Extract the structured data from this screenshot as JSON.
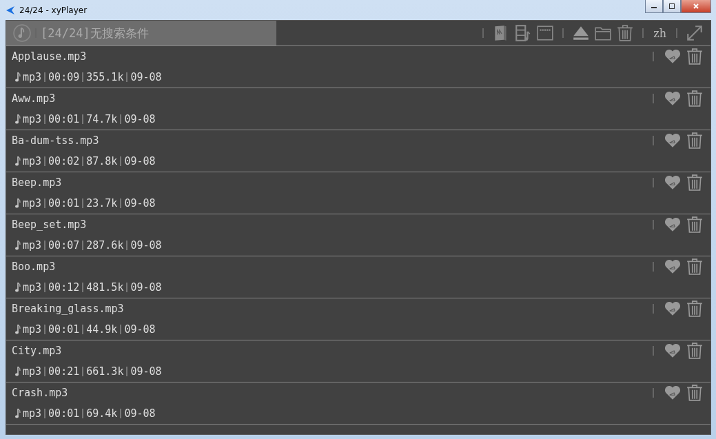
{
  "window": {
    "title": "24/24 - xyPlayer"
  },
  "search": {
    "placeholder": "[24/24]无搜索条件"
  },
  "toolbar": {
    "language": "zh"
  },
  "tracks": [
    {
      "name": "Applause.mp3",
      "format": "mp3",
      "duration": "00:09",
      "size": "355.1k",
      "date": "09-08"
    },
    {
      "name": "Aww.mp3",
      "format": "mp3",
      "duration": "00:01",
      "size": "74.7k",
      "date": "09-08"
    },
    {
      "name": "Ba-dum-tss.mp3",
      "format": "mp3",
      "duration": "00:02",
      "size": "87.8k",
      "date": "09-08"
    },
    {
      "name": "Beep.mp3",
      "format": "mp3",
      "duration": "00:01",
      "size": "23.7k",
      "date": "09-08"
    },
    {
      "name": "Beep_set.mp3",
      "format": "mp3",
      "duration": "00:07",
      "size": "287.6k",
      "date": "09-08"
    },
    {
      "name": "Boo.mp3",
      "format": "mp3",
      "duration": "00:12",
      "size": "481.5k",
      "date": "09-08"
    },
    {
      "name": "Breaking_glass.mp3",
      "format": "mp3",
      "duration": "00:01",
      "size": "44.9k",
      "date": "09-08"
    },
    {
      "name": "City.mp3",
      "format": "mp3",
      "duration": "00:21",
      "size": "661.3k",
      "date": "09-08"
    },
    {
      "name": "Crash.mp3",
      "format": "mp3",
      "duration": "00:01",
      "size": "69.4k",
      "date": "09-08"
    }
  ]
}
